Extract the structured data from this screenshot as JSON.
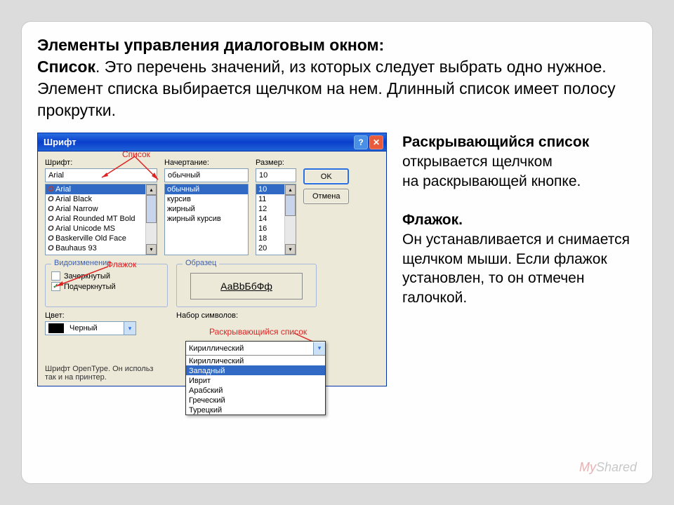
{
  "headline": {
    "title": "Элементы управления диалоговым окном:",
    "spisok_label": "Список",
    "spisok_text": ". Это перечень значений, из которых следует выбрать одно нужное. Элемент списка выбирается щелчком на нем. Длинный список имеет полосу прокрутки."
  },
  "side": {
    "p1_bold": "Раскрывающийся список",
    "p1_rest": " открывается щелчком",
    "p1_line2": " на раскрывающей кнопке.",
    "p2_bold": "Флажок.",
    "p2_l1": "Он устанавливается и снимается щелчком мыши. Если флажок установлен, то он отмечен галочкой."
  },
  "dialog": {
    "title": "Шрифт",
    "font_label": "Шрифт:",
    "font_value": "Arial",
    "font_items": [
      "Arial",
      "Arial Black",
      "Arial Narrow",
      "Arial Rounded MT Bold",
      "Arial Unicode MS",
      "Baskerville Old Face",
      "Bauhaus 93"
    ],
    "style_label": "Начертание:",
    "style_value": "обычный",
    "style_items": [
      "обычный",
      "курсив",
      "жирный",
      "жирный курсив"
    ],
    "size_label": "Размер:",
    "size_value": "10",
    "size_items": [
      "10",
      "11",
      "12",
      "14",
      "16",
      "18",
      "20"
    ],
    "ok": "OK",
    "cancel": "Отмена",
    "effects_legend": "Видоизменение",
    "strike_label": "Зачеркнутый",
    "underline_label": "Подчеркнутый",
    "sample_legend": "Образец",
    "sample_text": "АаВbБбФф",
    "color_label": "Цвет:",
    "color_value": "Черный",
    "charset_label": "Набор символов:",
    "charset_value": "Кириллический",
    "charset_items": [
      "Кириллический",
      "Западный",
      "Иврит",
      "Арабский",
      "Греческий",
      "Турецкий"
    ],
    "note": "Шрифт OpenType. Он использ",
    "note2": "так и на принтер."
  },
  "callouts": {
    "spisok": "Список",
    "flazhok": "Флажок",
    "dropdown": "Раскрывающийся список"
  },
  "watermark": {
    "my": "My",
    "shared": "Shared"
  }
}
